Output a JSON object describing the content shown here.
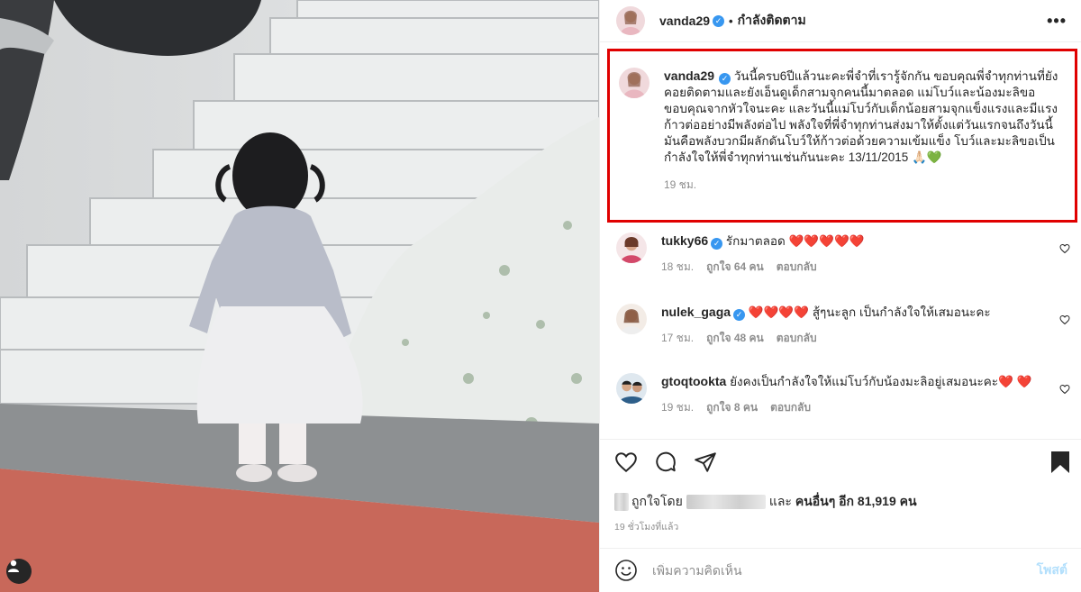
{
  "post": {
    "author": "vanda29",
    "follow_status": "กำลังติดตาม",
    "caption": "วันนี้ครบ6ปีแล้วนะคะพี่จำที่เรารู้จักกัน ขอบคุณพี่จำทุกท่านที่ยังคอยติดตามและยังเอ็นดูเด็กสามจุกคนนี้มาตลอด แม่โบว์และน้องมะลิขอขอบคุณจากหัวใจนะคะ และวันนี้แม่โบว์กับเด็กน้อยสามจุกแข็งแรงและมีแรงก้าวต่ออย่างมีพลังต่อไป พลังใจที่พี่จำทุกท่านส่งมาให้ตั้งแต่วันแรกจนถึงวันนี้มันคือพลังบวกมีผลักดันโบว์ให้ก้าวต่อด้วยความเข้มแข็ง โบว์และมะลิขอเป็นกำลังใจให้พี่จำทุกท่านเช่นกันนะคะ 13/11/2015 🙏🏻",
    "caption_heart": "💚",
    "caption_time": "19 ชม."
  },
  "comments": [
    {
      "username": "tukky66",
      "verified": true,
      "text": "รักมาตลอด",
      "hearts": "❤️❤️❤️❤️❤️",
      "time": "18 ชม.",
      "likes": "ถูกใจ 64 คน",
      "reply": "ตอบกลับ"
    },
    {
      "username": "nulek_gaga",
      "verified": true,
      "hearts": "❤️❤️❤️❤️",
      "text": "สู้ๆนะลูก เป็นกำลังใจให้เสมอนะคะ",
      "time": "17 ชม.",
      "likes": "ถูกใจ 48 คน",
      "reply": "ตอบกลับ"
    },
    {
      "username": "gtoqtookta",
      "verified": false,
      "text": "ยังคงเป็นกำลังใจให้แม่โบว์กับน้องมะลิอยู่เสมอนะคะ",
      "hearts": "❤️",
      "hearts2": "❤️",
      "time": "19 ชม.",
      "likes": "ถูกใจ 8 คน",
      "reply": "ตอบกลับ"
    }
  ],
  "likes_bar": {
    "prefix": "ถูกใจโดย",
    "and": "และ",
    "others": "คนอื่นๆ อีก 81,919 คน"
  },
  "timestamp": "19 ชั่วโมงที่แล้ว",
  "composer": {
    "placeholder": "เพิ่มความคิดเห็น",
    "post_label": "โพสต์"
  },
  "icons": {
    "verified": "verified-badge",
    "heart": "heart-icon",
    "comment": "comment-icon",
    "share": "share-icon",
    "save": "bookmark-icon",
    "emoji": "emoji-icon",
    "more": "more-icon",
    "user_tag": "user-tag-icon"
  },
  "colors": {
    "highlight_box": "#e00000",
    "verified": "#3897f0",
    "post_button": "#b2dffc",
    "heart": "#ed2f2f"
  }
}
